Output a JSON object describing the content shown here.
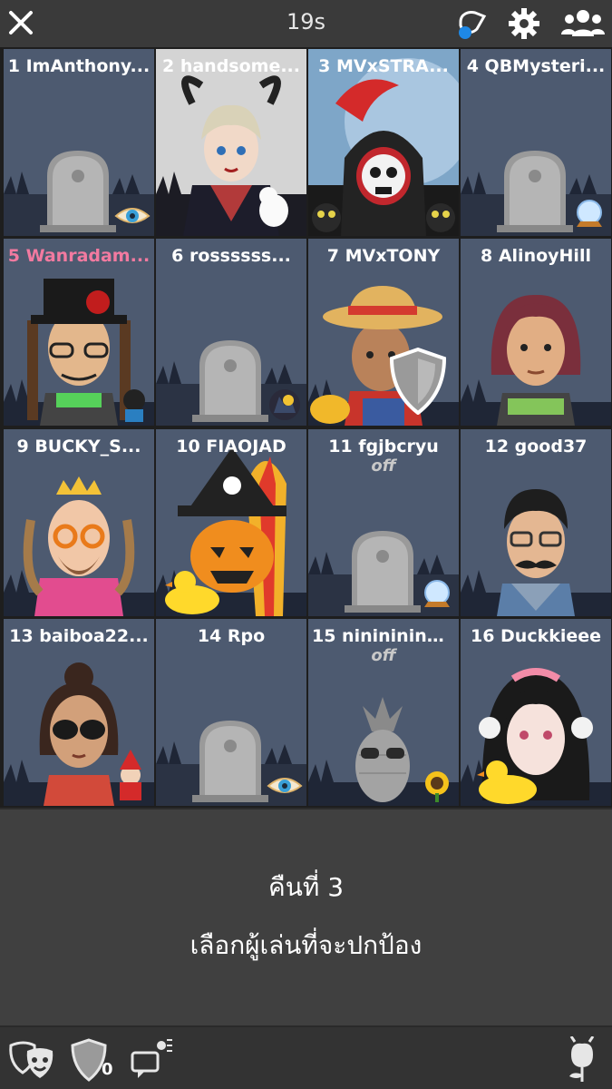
{
  "header": {
    "timer": "19s",
    "close_icon": "close-icon",
    "icons": [
      "voice-icon",
      "gear-icon",
      "players-icon"
    ],
    "accent": "#1e88e5"
  },
  "players": [
    {
      "num": 1,
      "label": "1 ImAnthony...",
      "state": "dead",
      "extra": "eye-icon"
    },
    {
      "num": 2,
      "label": "2 handsome...",
      "state": "alive",
      "avatar": "devil-avatar"
    },
    {
      "num": 3,
      "label": "3 MVxSTRA...",
      "state": "alive",
      "avatar": "reaper-avatar"
    },
    {
      "num": 4,
      "label": "4 QBMysteri...",
      "state": "dead",
      "extra": "crystal-ball-icon"
    },
    {
      "num": 5,
      "label": "5 Wanradam...",
      "state": "alive",
      "avatar": "tophat-avatar",
      "color": "#f27aa0"
    },
    {
      "num": 6,
      "label": "6 rossssss...",
      "state": "dead",
      "extra": "werewolf-icon"
    },
    {
      "num": 7,
      "label": "7 MVxTONY",
      "state": "alive",
      "avatar": "farmer-avatar",
      "extra": "shield-icon"
    },
    {
      "num": 8,
      "label": "8 AlinoyHill",
      "state": "alive",
      "avatar": "redhair-avatar"
    },
    {
      "num": 9,
      "label": "9 BUCKY_S...",
      "state": "alive",
      "avatar": "princess-avatar"
    },
    {
      "num": 10,
      "label": "10 FIAOJAD",
      "state": "alive",
      "avatar": "pumpkin-avatar"
    },
    {
      "num": 11,
      "label": "11 fgjbcryu",
      "state": "dead",
      "off": "off",
      "extra": "crystal-ball-icon"
    },
    {
      "num": 12,
      "label": "12 good37",
      "state": "alive",
      "avatar": "mustache-avatar"
    },
    {
      "num": 13,
      "label": "13 baiboa22...",
      "state": "alive",
      "avatar": "sunglasses-avatar"
    },
    {
      "num": 14,
      "label": "14 Rpo",
      "state": "dead",
      "extra": "eye-icon"
    },
    {
      "num": 15,
      "label": "15 nininininni...",
      "state": "pineapple",
      "off": "off",
      "extra": "sunflower-icon"
    },
    {
      "num": 16,
      "label": "16 Duckkieee",
      "state": "alive",
      "avatar": "anime-girl-avatar"
    }
  ],
  "info": {
    "night": "คืนที่ 3",
    "instruction": "เลือกผู้เล่นที่จะปกป้อง"
  },
  "toolbar": {
    "shield_count": "0",
    "icons": [
      "masks-icon",
      "shield-icon",
      "chat-icon",
      "rose-icon"
    ]
  }
}
